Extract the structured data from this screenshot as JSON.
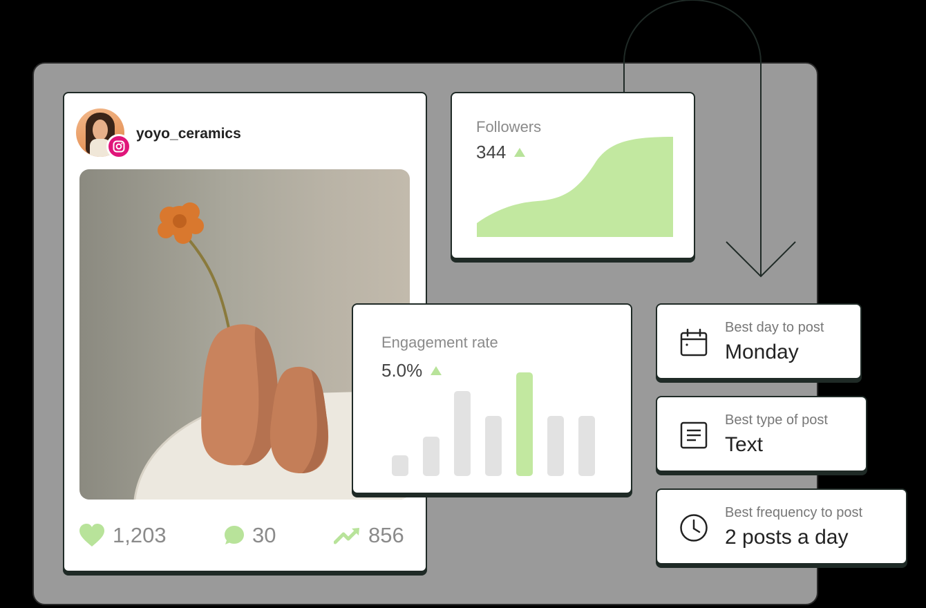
{
  "post": {
    "username": "yoyo_ceramics",
    "likes": "1,203",
    "comments": "30",
    "reach": "856"
  },
  "followers": {
    "title": "Followers",
    "value": "344",
    "trend": "up"
  },
  "engagement": {
    "title": "Engagement rate",
    "value": "5.0%",
    "trend": "up",
    "bars": [
      0.2,
      0.38,
      0.82,
      0.58,
      1.0,
      0.58,
      0.58
    ],
    "highlight_index": 4
  },
  "insights": [
    {
      "label": "Best day to post",
      "value": "Monday",
      "icon": "calendar-icon"
    },
    {
      "label": "Best type of post",
      "value": "Text",
      "icon": "document-icon"
    },
    {
      "label": "Best frequency to post",
      "value": "2 posts a day",
      "icon": "clock-icon"
    }
  ],
  "colors": {
    "accent_green": "#c2e8a0",
    "bar_gray": "#e2e2e2",
    "instagram_pink": "#e0157a",
    "panel_gray": "#9a9a9a"
  }
}
